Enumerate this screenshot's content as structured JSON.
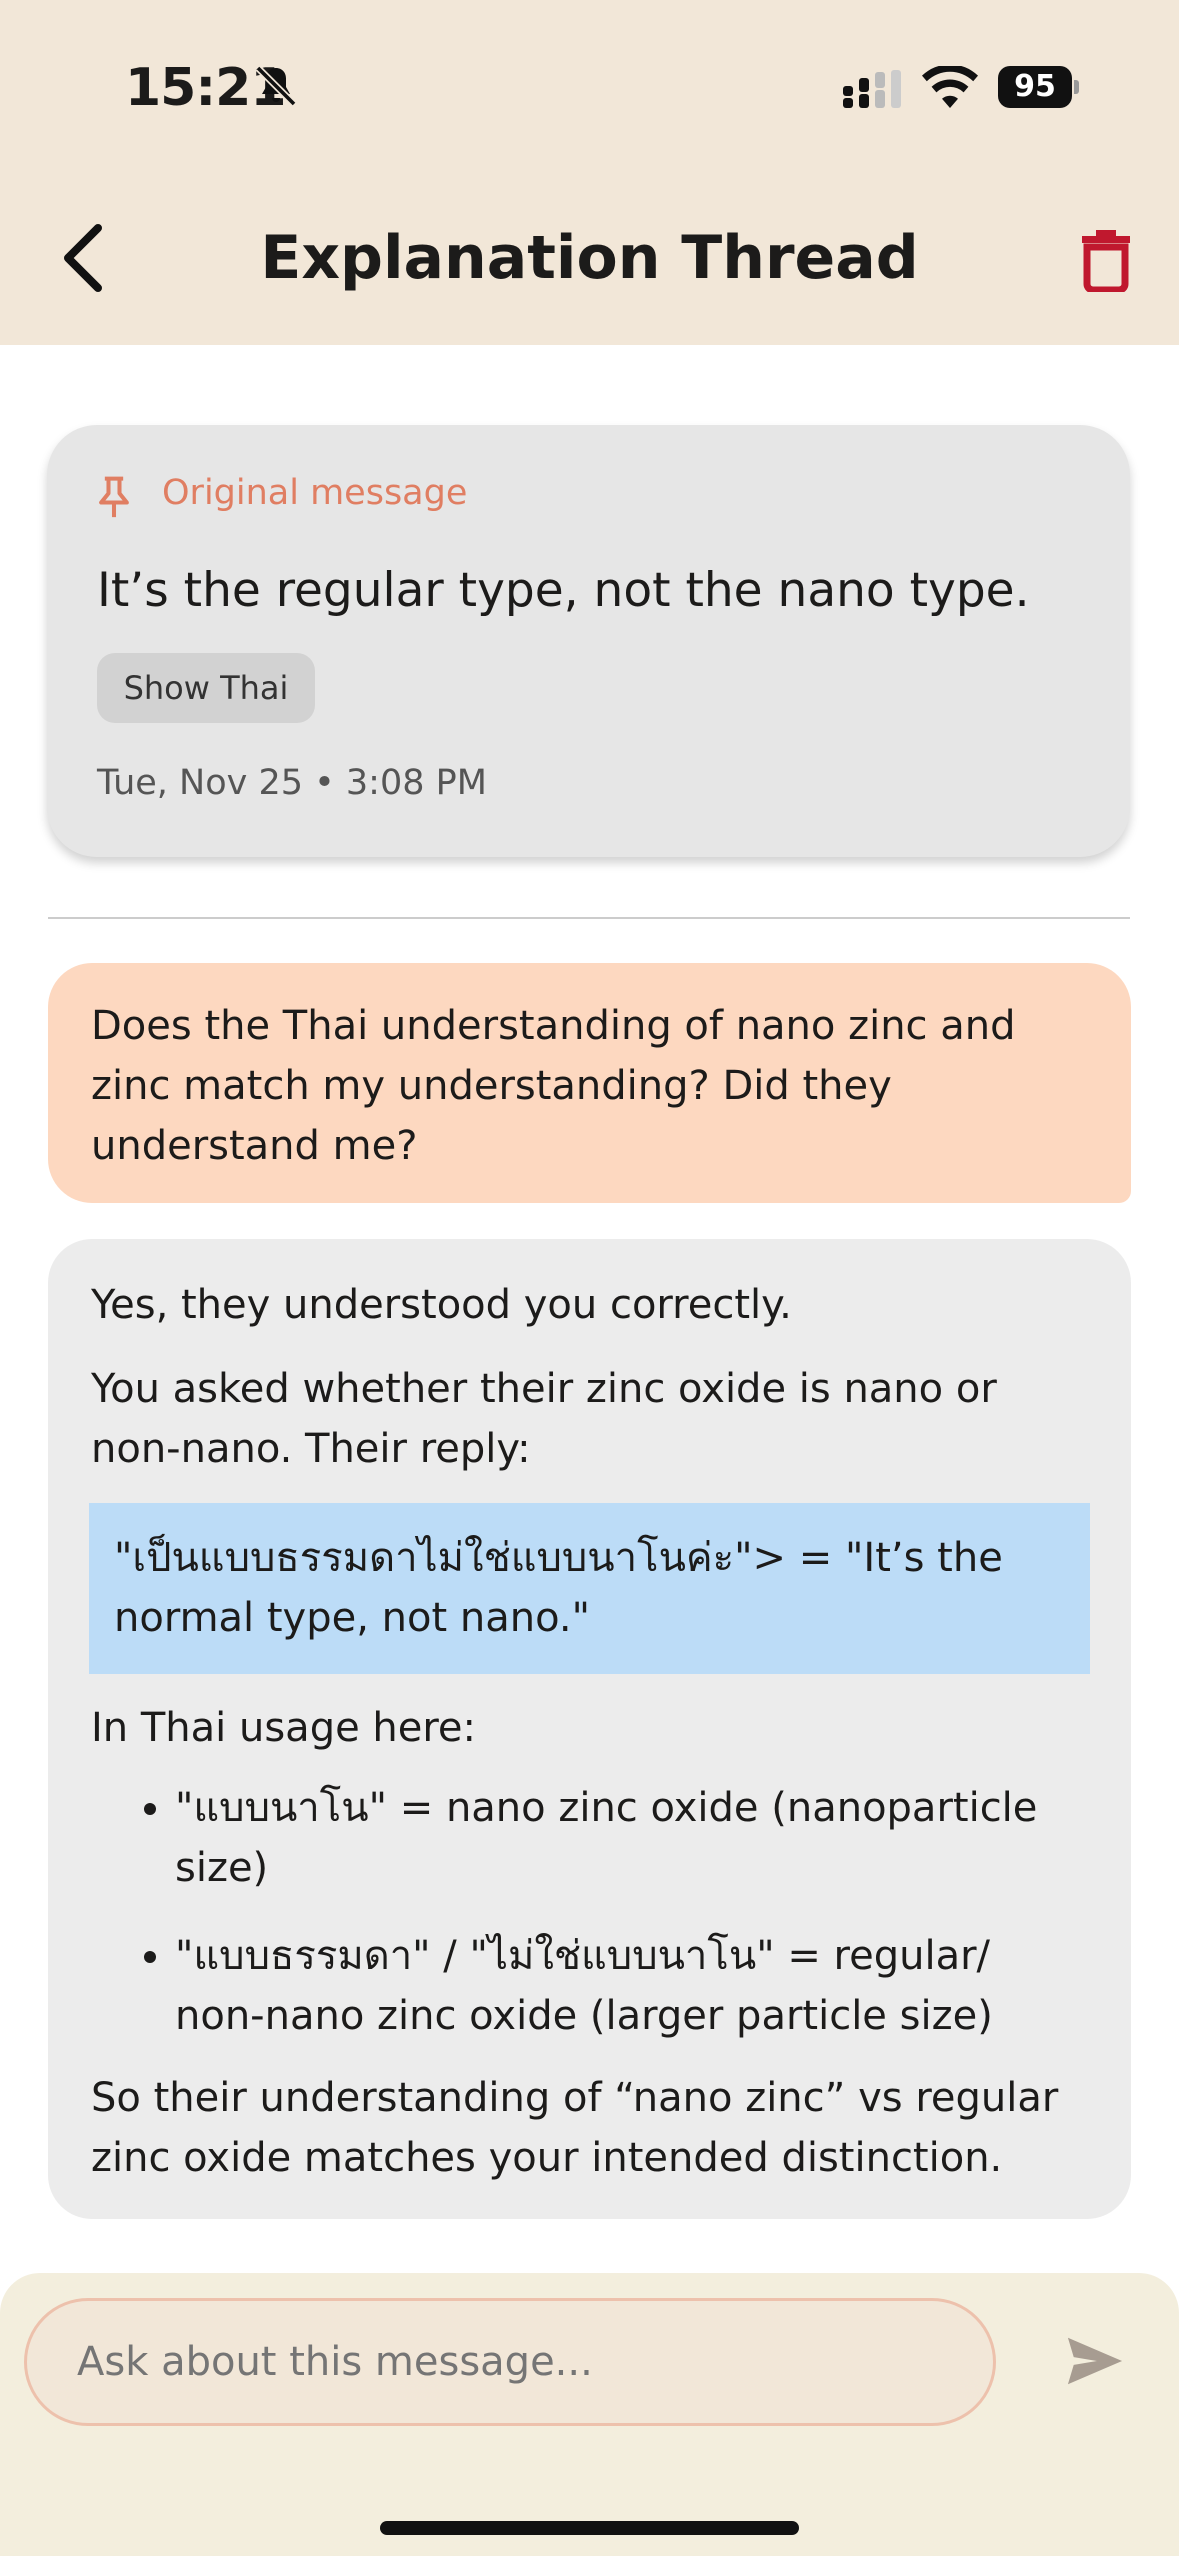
{
  "status_bar": {
    "time": "15:21",
    "battery": "95"
  },
  "header": {
    "title": "Explanation Thread"
  },
  "original_message": {
    "label": "Original message",
    "text": "It’s the regular type, not the nano type.",
    "show_thai_label": "Show Thai",
    "timestamp": "Tue, Nov 25 • 3:08 PM"
  },
  "user_message": {
    "text": "Does the Thai understanding of nano zinc and zinc match my understanding? Did they understand me?"
  },
  "assistant_message": {
    "p1": "Yes, they understood you correctly.",
    "p2": "You asked whether their zinc oxide is nano or non-nano. Their reply:",
    "quote": "\"เป็นแบบธรรมดาไม่ใช่แบบนาโนค่ะ\"> = \"It’s the normal type, not nano.\"",
    "p3": "In Thai usage here:",
    "bullets": [
      "\"แบบนาโน\" = nano zinc oxide (nanoparticle size)",
      "\"แบบธรรมดา\" / \"ไม่ใช่แบบนาโน\" = regular/ non-nano zinc oxide (larger particle size)"
    ],
    "p4": "So their understanding of “nano zinc” vs regular zinc oxide matches your intended distinction."
  },
  "composer": {
    "placeholder": "Ask about this message..."
  },
  "colors": {
    "header_bg": "#f2e7d8",
    "accent": "#e07e62",
    "delete": "#c0182e",
    "user_bubble": "#fdd8c0",
    "quote_bg": "#bcdcf7"
  }
}
